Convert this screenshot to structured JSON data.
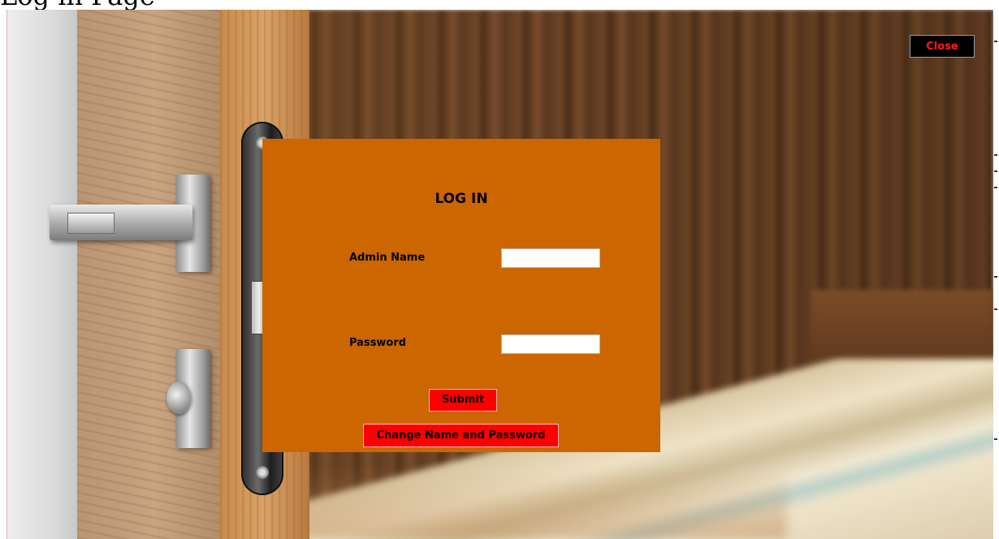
{
  "window": {
    "title": "Log in Page"
  },
  "toolbar": {
    "close_label": "Close"
  },
  "login": {
    "heading": "LOG IN",
    "admin_name_label": "Admin Name",
    "admin_name_value": "",
    "password_label": "Password",
    "password_value": "",
    "submit_label": "Submit",
    "change_label": "Change Name and Password"
  },
  "colors": {
    "panel_background": "#cc6600",
    "button_red": "#ff0000",
    "close_text": "#ff1a1a",
    "close_background": "#000000"
  },
  "icons": {
    "background_image": "door-lock-bedroom-photo"
  }
}
